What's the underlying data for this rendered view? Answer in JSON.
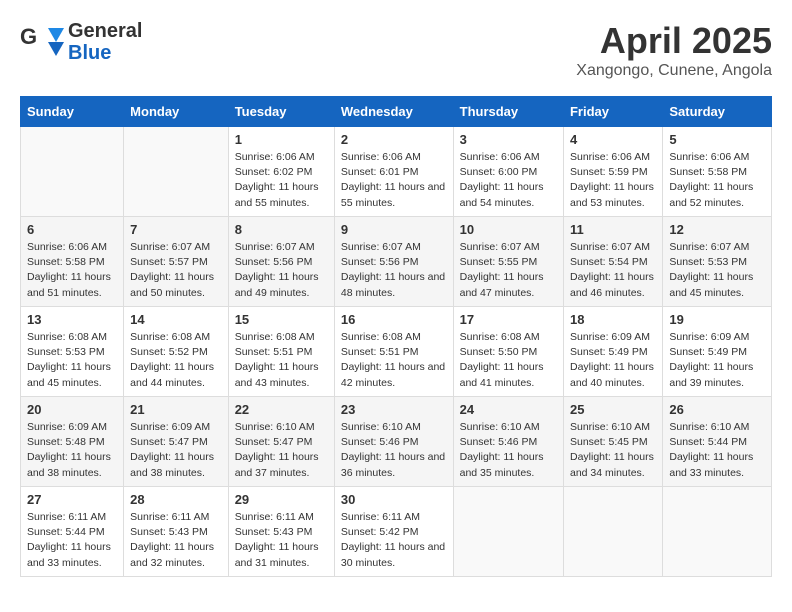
{
  "header": {
    "logo_line1": "General",
    "logo_line2": "Blue",
    "month": "April 2025",
    "location": "Xangongo, Cunene, Angola"
  },
  "weekdays": [
    "Sunday",
    "Monday",
    "Tuesday",
    "Wednesday",
    "Thursday",
    "Friday",
    "Saturday"
  ],
  "weeks": [
    [
      {
        "day": "",
        "detail": ""
      },
      {
        "day": "",
        "detail": ""
      },
      {
        "day": "1",
        "detail": "Sunrise: 6:06 AM\nSunset: 6:02 PM\nDaylight: 11 hours and 55 minutes."
      },
      {
        "day": "2",
        "detail": "Sunrise: 6:06 AM\nSunset: 6:01 PM\nDaylight: 11 hours and 55 minutes."
      },
      {
        "day": "3",
        "detail": "Sunrise: 6:06 AM\nSunset: 6:00 PM\nDaylight: 11 hours and 54 minutes."
      },
      {
        "day": "4",
        "detail": "Sunrise: 6:06 AM\nSunset: 5:59 PM\nDaylight: 11 hours and 53 minutes."
      },
      {
        "day": "5",
        "detail": "Sunrise: 6:06 AM\nSunset: 5:58 PM\nDaylight: 11 hours and 52 minutes."
      }
    ],
    [
      {
        "day": "6",
        "detail": "Sunrise: 6:06 AM\nSunset: 5:58 PM\nDaylight: 11 hours and 51 minutes."
      },
      {
        "day": "7",
        "detail": "Sunrise: 6:07 AM\nSunset: 5:57 PM\nDaylight: 11 hours and 50 minutes."
      },
      {
        "day": "8",
        "detail": "Sunrise: 6:07 AM\nSunset: 5:56 PM\nDaylight: 11 hours and 49 minutes."
      },
      {
        "day": "9",
        "detail": "Sunrise: 6:07 AM\nSunset: 5:56 PM\nDaylight: 11 hours and 48 minutes."
      },
      {
        "day": "10",
        "detail": "Sunrise: 6:07 AM\nSunset: 5:55 PM\nDaylight: 11 hours and 47 minutes."
      },
      {
        "day": "11",
        "detail": "Sunrise: 6:07 AM\nSunset: 5:54 PM\nDaylight: 11 hours and 46 minutes."
      },
      {
        "day": "12",
        "detail": "Sunrise: 6:07 AM\nSunset: 5:53 PM\nDaylight: 11 hours and 45 minutes."
      }
    ],
    [
      {
        "day": "13",
        "detail": "Sunrise: 6:08 AM\nSunset: 5:53 PM\nDaylight: 11 hours and 45 minutes."
      },
      {
        "day": "14",
        "detail": "Sunrise: 6:08 AM\nSunset: 5:52 PM\nDaylight: 11 hours and 44 minutes."
      },
      {
        "day": "15",
        "detail": "Sunrise: 6:08 AM\nSunset: 5:51 PM\nDaylight: 11 hours and 43 minutes."
      },
      {
        "day": "16",
        "detail": "Sunrise: 6:08 AM\nSunset: 5:51 PM\nDaylight: 11 hours and 42 minutes."
      },
      {
        "day": "17",
        "detail": "Sunrise: 6:08 AM\nSunset: 5:50 PM\nDaylight: 11 hours and 41 minutes."
      },
      {
        "day": "18",
        "detail": "Sunrise: 6:09 AM\nSunset: 5:49 PM\nDaylight: 11 hours and 40 minutes."
      },
      {
        "day": "19",
        "detail": "Sunrise: 6:09 AM\nSunset: 5:49 PM\nDaylight: 11 hours and 39 minutes."
      }
    ],
    [
      {
        "day": "20",
        "detail": "Sunrise: 6:09 AM\nSunset: 5:48 PM\nDaylight: 11 hours and 38 minutes."
      },
      {
        "day": "21",
        "detail": "Sunrise: 6:09 AM\nSunset: 5:47 PM\nDaylight: 11 hours and 38 minutes."
      },
      {
        "day": "22",
        "detail": "Sunrise: 6:10 AM\nSunset: 5:47 PM\nDaylight: 11 hours and 37 minutes."
      },
      {
        "day": "23",
        "detail": "Sunrise: 6:10 AM\nSunset: 5:46 PM\nDaylight: 11 hours and 36 minutes."
      },
      {
        "day": "24",
        "detail": "Sunrise: 6:10 AM\nSunset: 5:46 PM\nDaylight: 11 hours and 35 minutes."
      },
      {
        "day": "25",
        "detail": "Sunrise: 6:10 AM\nSunset: 5:45 PM\nDaylight: 11 hours and 34 minutes."
      },
      {
        "day": "26",
        "detail": "Sunrise: 6:10 AM\nSunset: 5:44 PM\nDaylight: 11 hours and 33 minutes."
      }
    ],
    [
      {
        "day": "27",
        "detail": "Sunrise: 6:11 AM\nSunset: 5:44 PM\nDaylight: 11 hours and 33 minutes."
      },
      {
        "day": "28",
        "detail": "Sunrise: 6:11 AM\nSunset: 5:43 PM\nDaylight: 11 hours and 32 minutes."
      },
      {
        "day": "29",
        "detail": "Sunrise: 6:11 AM\nSunset: 5:43 PM\nDaylight: 11 hours and 31 minutes."
      },
      {
        "day": "30",
        "detail": "Sunrise: 6:11 AM\nSunset: 5:42 PM\nDaylight: 11 hours and 30 minutes."
      },
      {
        "day": "",
        "detail": ""
      },
      {
        "day": "",
        "detail": ""
      },
      {
        "day": "",
        "detail": ""
      }
    ]
  ]
}
